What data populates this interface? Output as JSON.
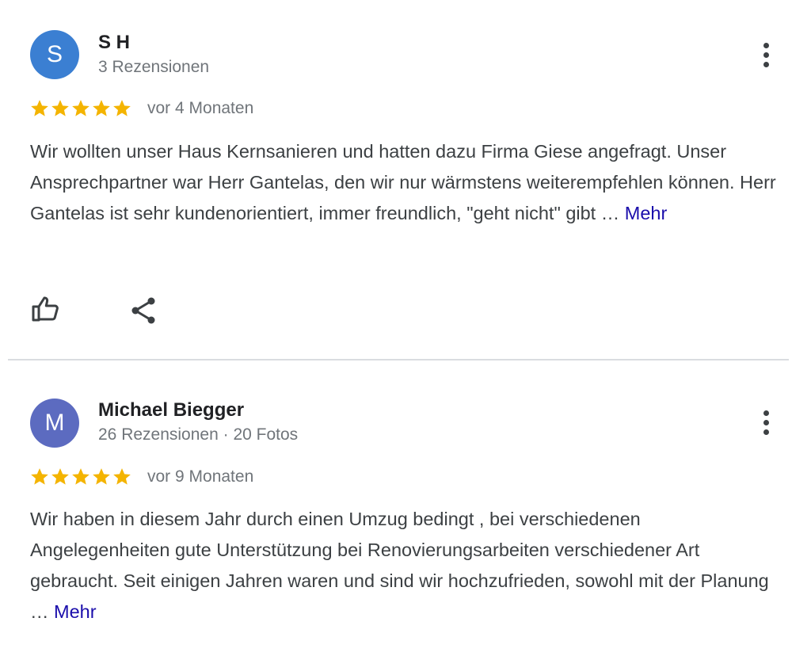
{
  "reviews": [
    {
      "avatar_letter": "S",
      "avatar_color": "#3b7fd2",
      "name": "S H",
      "meta": "3 Rezensionen",
      "rating": 5,
      "date": "vor 4 Monaten",
      "text": "Wir wollten unser Haus Kernsanieren und hatten dazu Firma Giese angefragt. Unser Ansprechpartner war Herr Gantelas, den wir nur wärmstens weiterempfehlen können. Herr Gantelas ist sehr kundenorientiert, immer freundlich, \"geht nicht\" gibt … ",
      "more_label": "Mehr"
    },
    {
      "avatar_letter": "M",
      "avatar_color": "#5c6bc0",
      "name": "Michael Biegger",
      "meta": "26 Rezensionen · 20 Fotos",
      "rating": 5,
      "date": "vor 9 Monaten",
      "text": "Wir haben in diesem Jahr durch einen Umzug bedingt , bei verschiedenen Angelegenheiten gute Unterstützung bei Renovierungsarbeiten verschiedener Art gebraucht. Seit einigen Jahren waren und sind wir hochzufrieden, sowohl mit der Planung … ",
      "more_label": "Mehr"
    }
  ],
  "colors": {
    "star": "#f4b400",
    "link": "#1a0dab",
    "divider": "#dadce0"
  },
  "icons": [
    "like-icon",
    "share-icon",
    "more-vert-icon",
    "star-icon"
  ]
}
